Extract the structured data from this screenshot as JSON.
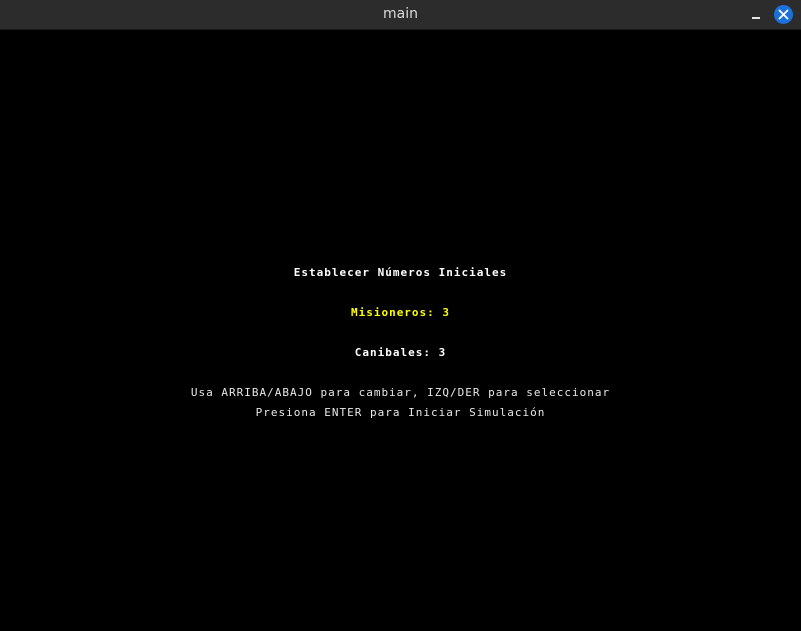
{
  "window": {
    "title": "main"
  },
  "icons": {
    "minimize": "minimize-icon",
    "close": "close-icon"
  },
  "colors": {
    "titlebar": "#2c2c2c",
    "close_button": "#1c71d8",
    "background": "#000000",
    "text": "#ffffff",
    "highlight": "#ffff00"
  },
  "menu": {
    "heading": "Establecer Números Iniciales",
    "missionaries_label": "Misioneros: 3",
    "cannibals_label": "Canibales: 3",
    "instructions": "Usa ARRIBA/ABAJO para cambiar, IZQ/DER para seleccionar",
    "start_prompt": "Presiona ENTER para Iniciar Simulación"
  }
}
